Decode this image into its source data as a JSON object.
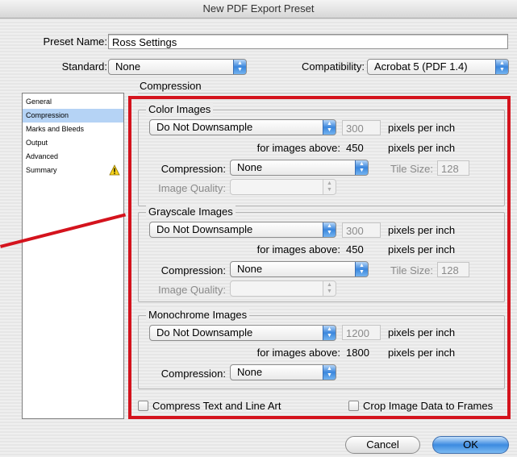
{
  "window": {
    "title": "New PDF Export Preset"
  },
  "preset": {
    "label": "Preset Name:",
    "value": "Ross Settings"
  },
  "standard": {
    "label": "Standard:",
    "value": "None"
  },
  "compatibility": {
    "label": "Compatibility:",
    "value": "Acrobat 5 (PDF 1.4)"
  },
  "sidebar": {
    "items": [
      {
        "label": "General",
        "selected": false
      },
      {
        "label": "Compression",
        "selected": true
      },
      {
        "label": "Marks and Bleeds",
        "selected": false
      },
      {
        "label": "Output",
        "selected": false
      },
      {
        "label": "Advanced",
        "selected": false
      },
      {
        "label": "Summary",
        "selected": false,
        "icon": "warning-icon"
      }
    ]
  },
  "panel": {
    "title": "Compression"
  },
  "color": {
    "title": "Color Images",
    "downsample": "Do Not Downsample",
    "ppi": "300",
    "ppi_unit": "pixels per inch",
    "above_label": "for images above:",
    "above_value": "450",
    "above_unit": "pixels per inch",
    "compression_label": "Compression:",
    "compression_value": "None",
    "tile_label": "Tile Size:",
    "tile_value": "128",
    "quality_label": "Image Quality:",
    "quality_value": ""
  },
  "gray": {
    "title": "Grayscale Images",
    "downsample": "Do Not Downsample",
    "ppi": "300",
    "ppi_unit": "pixels per inch",
    "above_label": "for images above:",
    "above_value": "450",
    "above_unit": "pixels per inch",
    "compression_label": "Compression:",
    "compression_value": "None",
    "tile_label": "Tile Size:",
    "tile_value": "128",
    "quality_label": "Image Quality:",
    "quality_value": ""
  },
  "mono": {
    "title": "Monochrome Images",
    "downsample": "Do Not Downsample",
    "ppi": "1200",
    "ppi_unit": "pixels per inch",
    "above_label": "for images above:",
    "above_value": "1800",
    "above_unit": "pixels per inch",
    "compression_label": "Compression:",
    "compression_value": "None"
  },
  "options": {
    "compress_text": {
      "label": "Compress Text and Line Art",
      "checked": false
    },
    "crop_image": {
      "label": "Crop Image Data to Frames",
      "checked": false
    }
  },
  "buttons": {
    "cancel": "Cancel",
    "ok": "OK"
  },
  "colors": {
    "highlight": "#d4131d",
    "accent": "#3d8be0",
    "selection": "#b5d3f5"
  }
}
